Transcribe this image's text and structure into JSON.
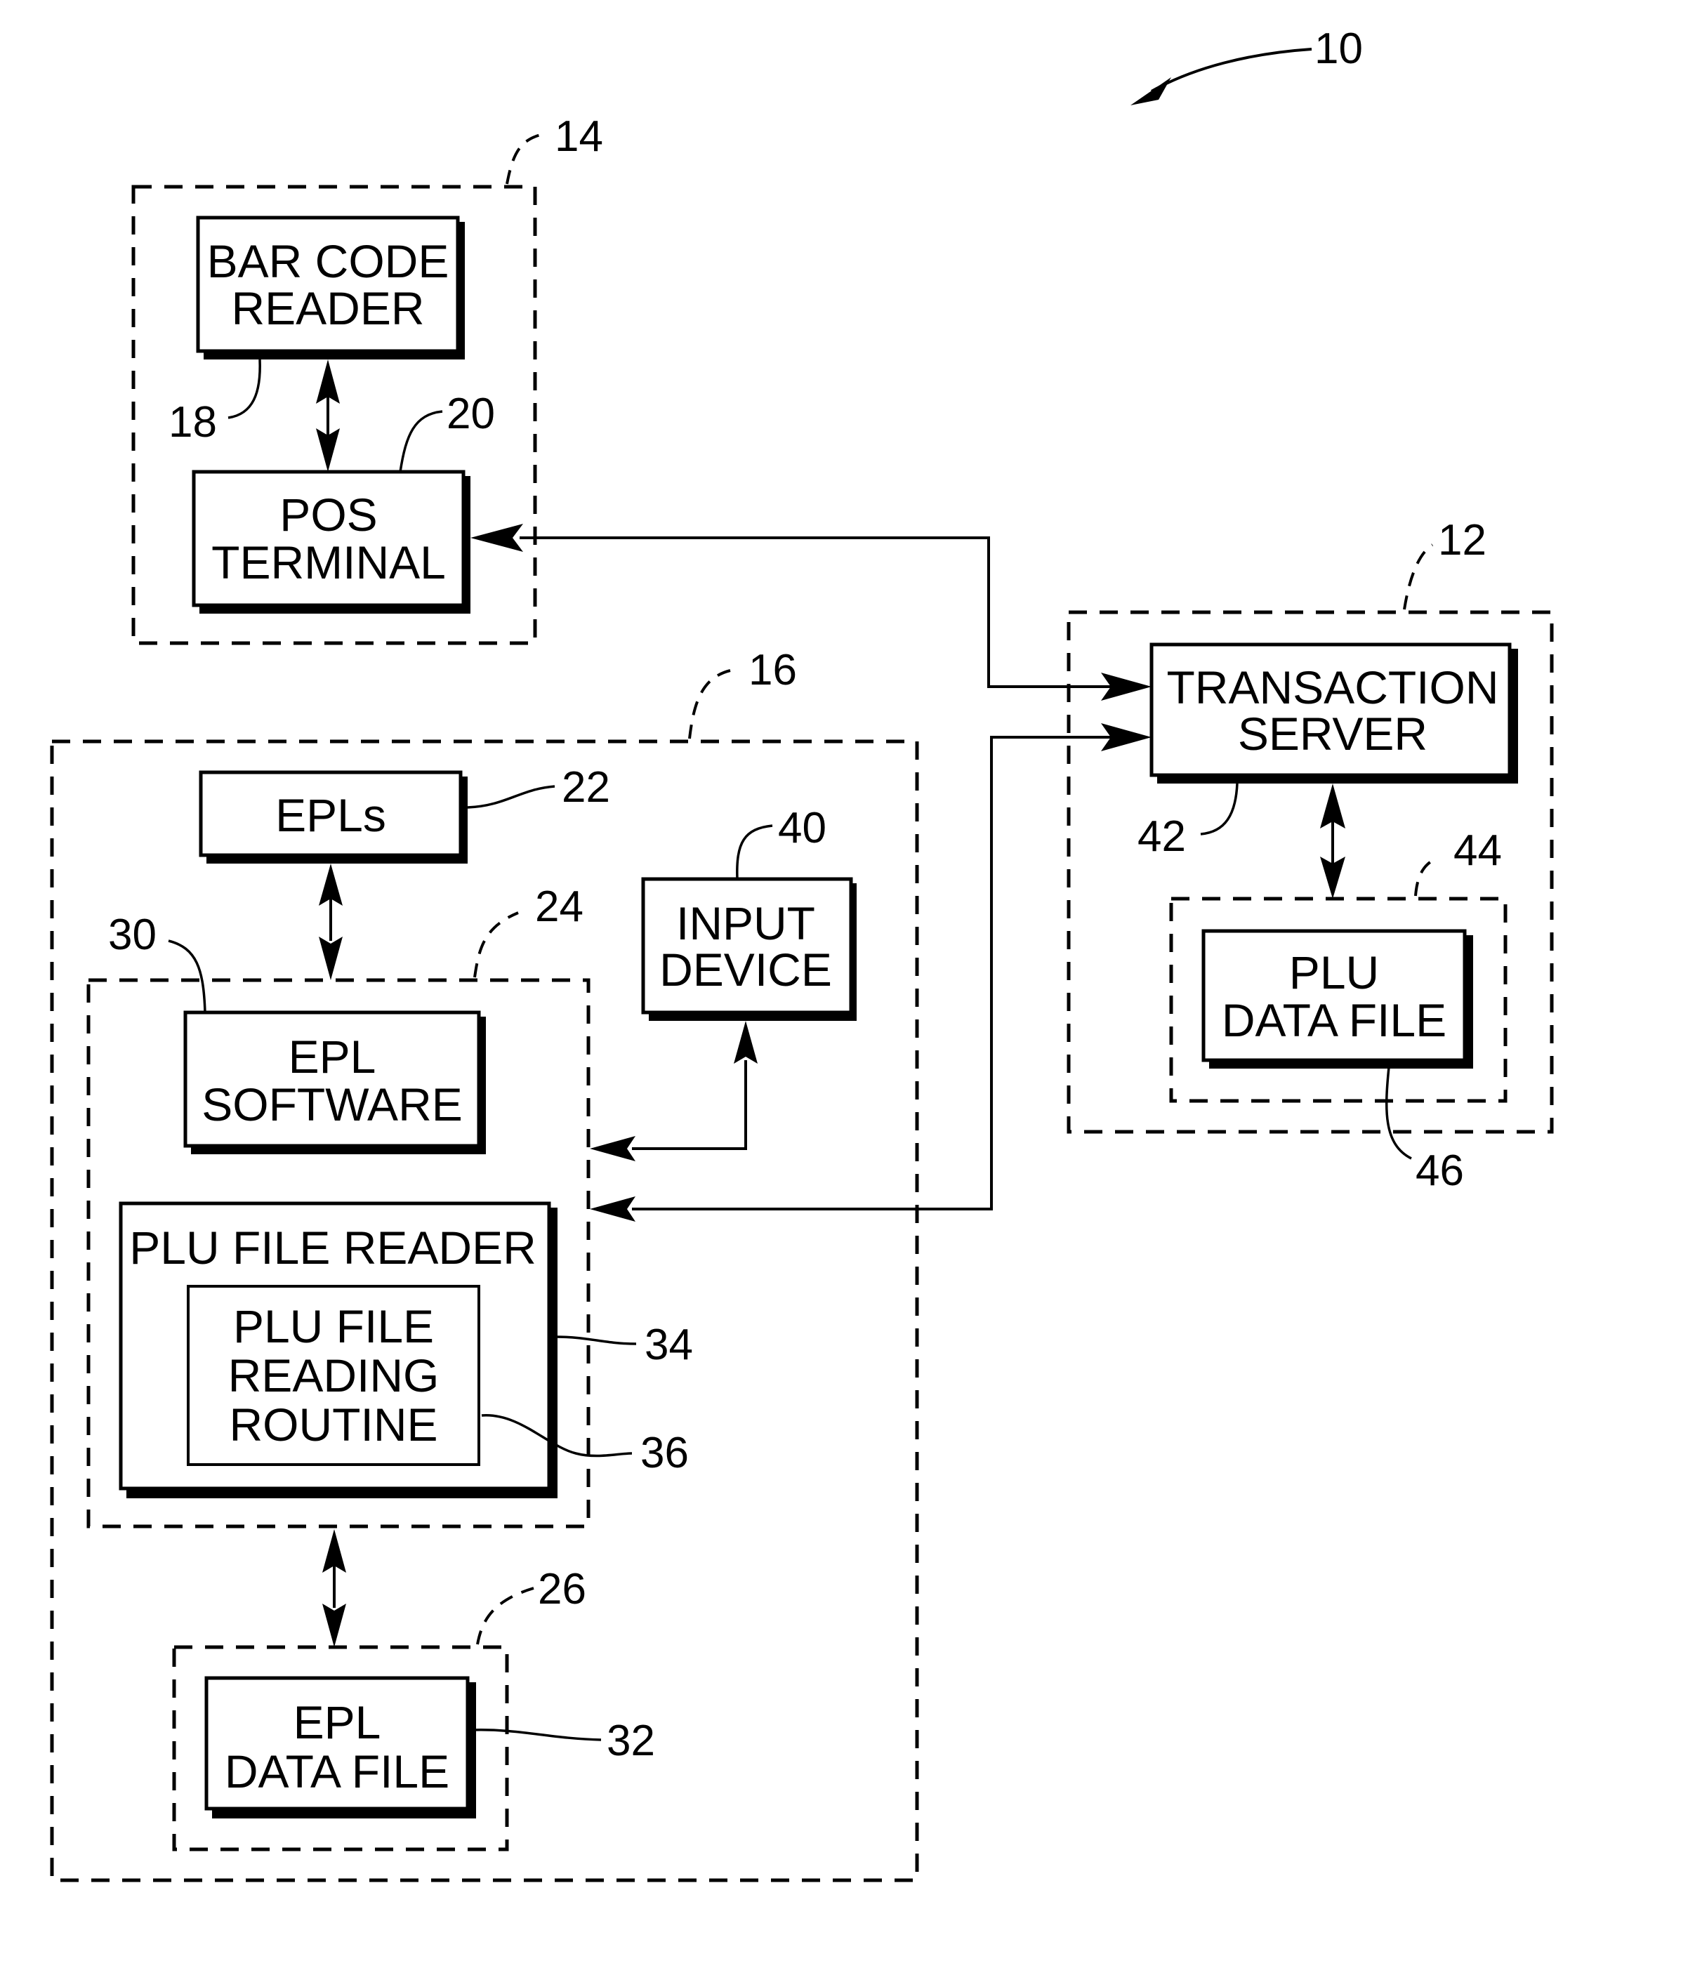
{
  "figure": {
    "ref": "10",
    "groups": {
      "checkout": {
        "ref": "14"
      },
      "server_system": {
        "ref": "12"
      },
      "epl_system": {
        "ref": "16"
      },
      "epl_computer": {
        "ref": "24"
      },
      "epl_storage": {
        "ref": "26"
      },
      "plu_storage": {
        "ref": "44"
      }
    },
    "blocks": {
      "bar_code_reader": {
        "lines": [
          "BAR CODE",
          "READER"
        ],
        "ref": "18"
      },
      "pos_terminal": {
        "lines": [
          "POS",
          "TERMINAL"
        ],
        "ref": "20"
      },
      "transaction_server": {
        "lines": [
          "TRANSACTION",
          "SERVER"
        ],
        "ref": "42"
      },
      "plu_data_file": {
        "lines": [
          "PLU",
          "DATA FILE"
        ],
        "ref": "46"
      },
      "epls": {
        "lines": [
          "EPLs"
        ],
        "ref": "22"
      },
      "input_device": {
        "lines": [
          "INPUT",
          "DEVICE"
        ],
        "ref": "40"
      },
      "epl_software": {
        "lines": [
          "EPL",
          "SOFTWARE"
        ],
        "ref": "30"
      },
      "plu_file_reader": {
        "lines": [
          "PLU FILE READER"
        ],
        "ref": "34"
      },
      "plu_file_reading_routine": {
        "lines": [
          "PLU FILE",
          "READING",
          "ROUTINE"
        ],
        "ref": "36"
      },
      "epl_data_file": {
        "lines": [
          "EPL",
          "DATA FILE"
        ],
        "ref": "32"
      }
    }
  }
}
